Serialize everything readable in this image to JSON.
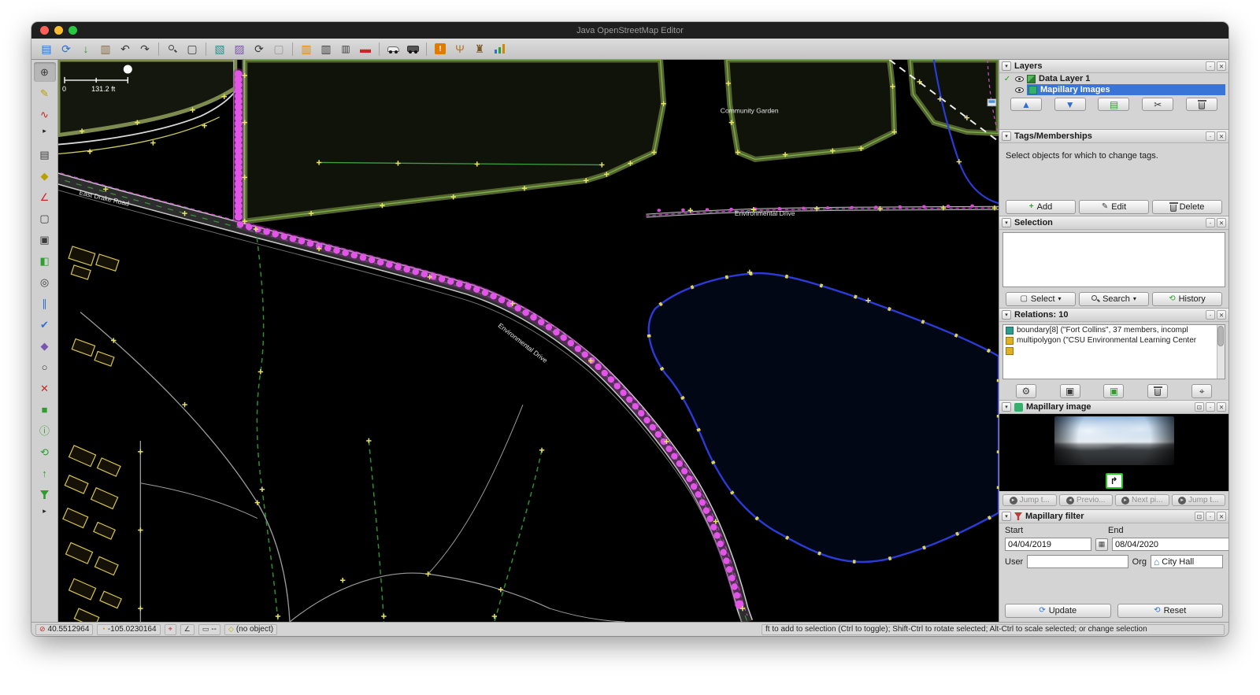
{
  "window": {
    "title": "Java OpenStreetMap Editor"
  },
  "colors": {
    "selection_blue": "#3875d7",
    "mapillary_magenta": "#e355e8",
    "water_blue": "#2b3bd6",
    "node_yellow": "#e8e463",
    "mapillary_green": "#22c822"
  },
  "map": {
    "scale_zero": "0",
    "scale_label": "131.2 ft",
    "labels": {
      "community_garden": "Community Garden",
      "environmental_drive_h": "Environmental Drive",
      "environmental_drive_diag": "Environmental Drive",
      "east_drake_road": "East Drake Road"
    }
  },
  "toolbar": {
    "icons": {
      "open": "▤",
      "sync": "⟳",
      "download": "↓",
      "upload": "▥",
      "undo": "↶",
      "redo": "↷",
      "zoom": "◎",
      "area": "▢",
      "imagery": "▧",
      "style": "▨",
      "refresh": "⟳",
      "blank": "▢",
      "columns": "▥",
      "lanes": "▥",
      "restriction": "▬",
      "warning": "!",
      "food": "Ψ",
      "castle": "♜"
    }
  },
  "sidetools": {
    "icons": {
      "pan": "⊕",
      "draw": "✎",
      "improve": "∿",
      "expand": "▸",
      "layers": "▤",
      "tag": "◆",
      "measure": "∠",
      "selbox": "▢",
      "editbox": "▣",
      "movebox": "◧",
      "zoombox": "◎",
      "parallel": "∥",
      "validate": "✔",
      "wand": "◆",
      "circle": "○",
      "delete": "✕",
      "terrace": "■",
      "info": "ⓘ",
      "history": "⟲",
      "upload": "↑",
      "expand2": "▸"
    }
  },
  "ui": {
    "collapse": "▾",
    "sticky": "-",
    "close": "✕",
    "detach": "⊡",
    "dropdown": "▾",
    "check": "✓",
    "calendar": "▦",
    "org_icon": "⌂",
    "update_icon": "⟳",
    "reset_icon": "⟲",
    "turn_icon": "↱",
    "nav_jump": "►",
    "nav_prev": "◄",
    "nav_next": "►",
    "plus": "+",
    "pencil": "✎",
    "gear": "⚙",
    "copy": "▣",
    "target": "⌖",
    "up": "▲",
    "down": "▼",
    "layers_merge": "▤",
    "scissors": "✂"
  },
  "panels": {
    "layers": {
      "title": "Layers",
      "rows": [
        {
          "label": "Data Layer 1"
        },
        {
          "label": "Mapillary Images"
        }
      ]
    },
    "tags": {
      "title": "Tags/Memberships",
      "hint": "Select objects for which to change tags.",
      "add": "Add",
      "edit": "Edit",
      "delete": "Delete"
    },
    "selection": {
      "title": "Selection",
      "select": "Select",
      "search": "Search",
      "history": "History"
    },
    "relations": {
      "title": "Relations: 10",
      "items": [
        "boundary[8] (\"Fort Collins\", 37 members, incompl",
        "multipolygon (\"CSU Environmental Learning Center"
      ]
    },
    "mapillary_image": {
      "title": "Mapillary image",
      "buttons": [
        "Jump t...",
        "Previo...",
        "Next pi...",
        "Jump t..."
      ]
    },
    "mapillary_filter": {
      "title": "Mapillary filter",
      "start_label": "Start",
      "end_label": "End",
      "start_value": "04/04/2019",
      "end_value": "08/04/2020",
      "user_label": "User",
      "org_label": "Org",
      "org_value": "City Hall",
      "update": "Update",
      "reset": "Reset"
    }
  },
  "statusbar": {
    "lat": "40.5512964",
    "lon": "-105.0230164",
    "dist": "--",
    "object": "(no object)",
    "help": "ft to add to selection (Ctrl to toggle); Shift-Ctrl to rotate selected; Alt-Ctrl to scale selected; or change selection",
    "icons": {
      "lat": "⊘",
      "lon": "◔",
      "compass": "⌖",
      "angle": "∠",
      "ruler": "▭",
      "object": "◇"
    }
  }
}
